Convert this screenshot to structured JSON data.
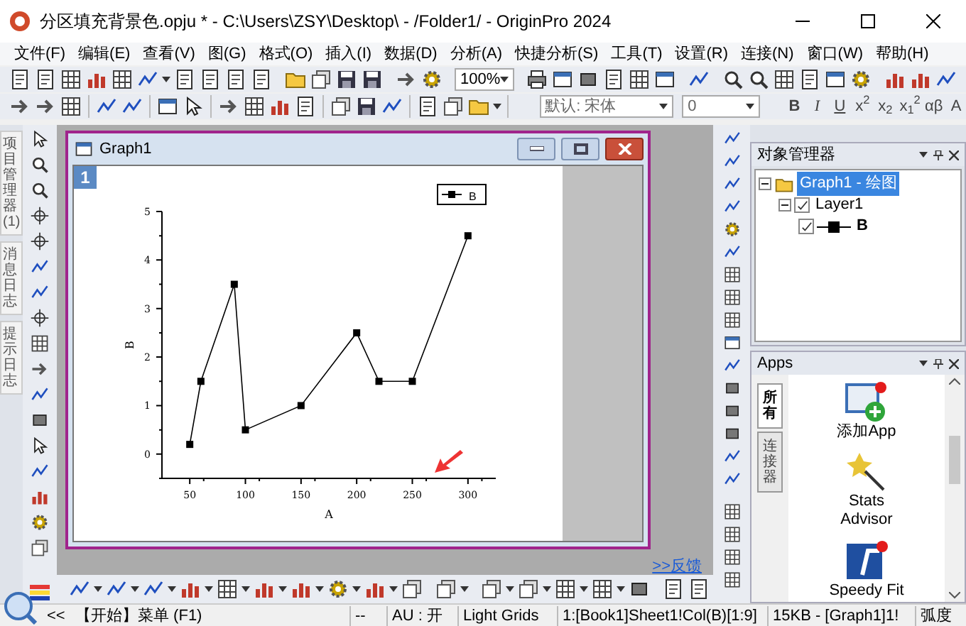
{
  "window": {
    "title": "分区填充背景色.opju * - C:\\Users\\ZSY\\Desktop\\ - /Folder1/ - OriginPro 2024"
  },
  "menu": [
    "文件(F)",
    "编辑(E)",
    "查看(V)",
    "图(G)",
    "格式(O)",
    "插入(I)",
    "数据(D)",
    "分析(A)",
    "快捷分析(S)",
    "工具(T)",
    "设置(R)",
    "连接(N)",
    "窗口(W)",
    "帮助(H)"
  ],
  "toolbar": {
    "zoom": "100%",
    "font": "默认: 宋体",
    "font_size": "0",
    "format_buttons": [
      "B",
      "I",
      "U",
      "x$^{2}$",
      "x$_{2}$",
      "x$_{1}$$^{2}$",
      "αβ",
      "A"
    ]
  },
  "side_tabs": [
    "项目管理器 (1)",
    "消息日志",
    "提示日志"
  ],
  "graph_window": {
    "title": "Graph1",
    "layer": "1",
    "chart_data": {
      "type": "line",
      "xlabel": "A",
      "ylabel": "B",
      "x": [
        50,
        60,
        90,
        100,
        150,
        200,
        220,
        250,
        300
      ],
      "series": [
        {
          "name": "B",
          "color": "#000000",
          "marker": "square",
          "values": [
            0.2,
            1.5,
            3.5,
            0.5,
            1,
            2.5,
            1.5,
            1.5,
            4.5
          ]
        }
      ],
      "xlim": [
        25,
        325
      ],
      "ylim": [
        -0.5,
        5
      ],
      "xticks": [
        50,
        100,
        150,
        200,
        250,
        300
      ],
      "yticks": [
        0,
        1,
        2,
        3,
        4,
        5
      ]
    }
  },
  "feedback_link": ">>反馈",
  "object_manager": {
    "title": "对象管理器",
    "tree": [
      {
        "label": "Graph1 - 绘图",
        "selected": true,
        "expanded": true,
        "children": [
          {
            "label": "Layer1",
            "checked": true,
            "selected": false,
            "expanded": true,
            "children": [
              {
                "label": "B",
                "checked": true,
                "selected": false
              }
            ]
          }
        ]
      }
    ]
  },
  "apps": {
    "title": "Apps",
    "tabs": [
      {
        "label": "所有",
        "selected": true
      },
      {
        "label": "连接器",
        "selected": false
      }
    ],
    "items": [
      "添加App",
      "Stats Advisor",
      "Speedy Fit"
    ]
  },
  "status_bar": [
    "<<",
    "【开始】菜单 (F1)",
    "--",
    "AU : 开",
    "Light Grids",
    "1:[Book1]Sheet1!Col(B)[1:9]",
    "15KB - [Graph1]1!",
    "弧度"
  ]
}
